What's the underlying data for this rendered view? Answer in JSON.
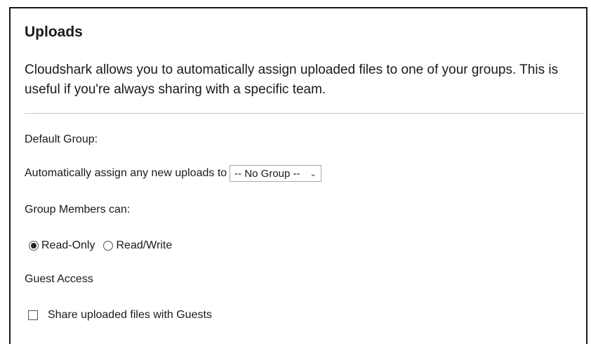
{
  "section": {
    "title": "Uploads",
    "intro": "Cloudshark allows you to automatically assign uploaded files to one of your groups. This is useful if you're always sharing with a specific team."
  },
  "default_group": {
    "label": "Default Group:",
    "assign_text": "Automatically assign any new uploads to",
    "select_value": "-- No Group --"
  },
  "permissions": {
    "label": "Group Members can:",
    "options": [
      {
        "label": "Read-Only",
        "selected": true
      },
      {
        "label": "Read/Write",
        "selected": false
      }
    ]
  },
  "guest": {
    "label": "Guest Access",
    "checkbox_label": "Share uploaded files with Guests",
    "checked": false
  }
}
